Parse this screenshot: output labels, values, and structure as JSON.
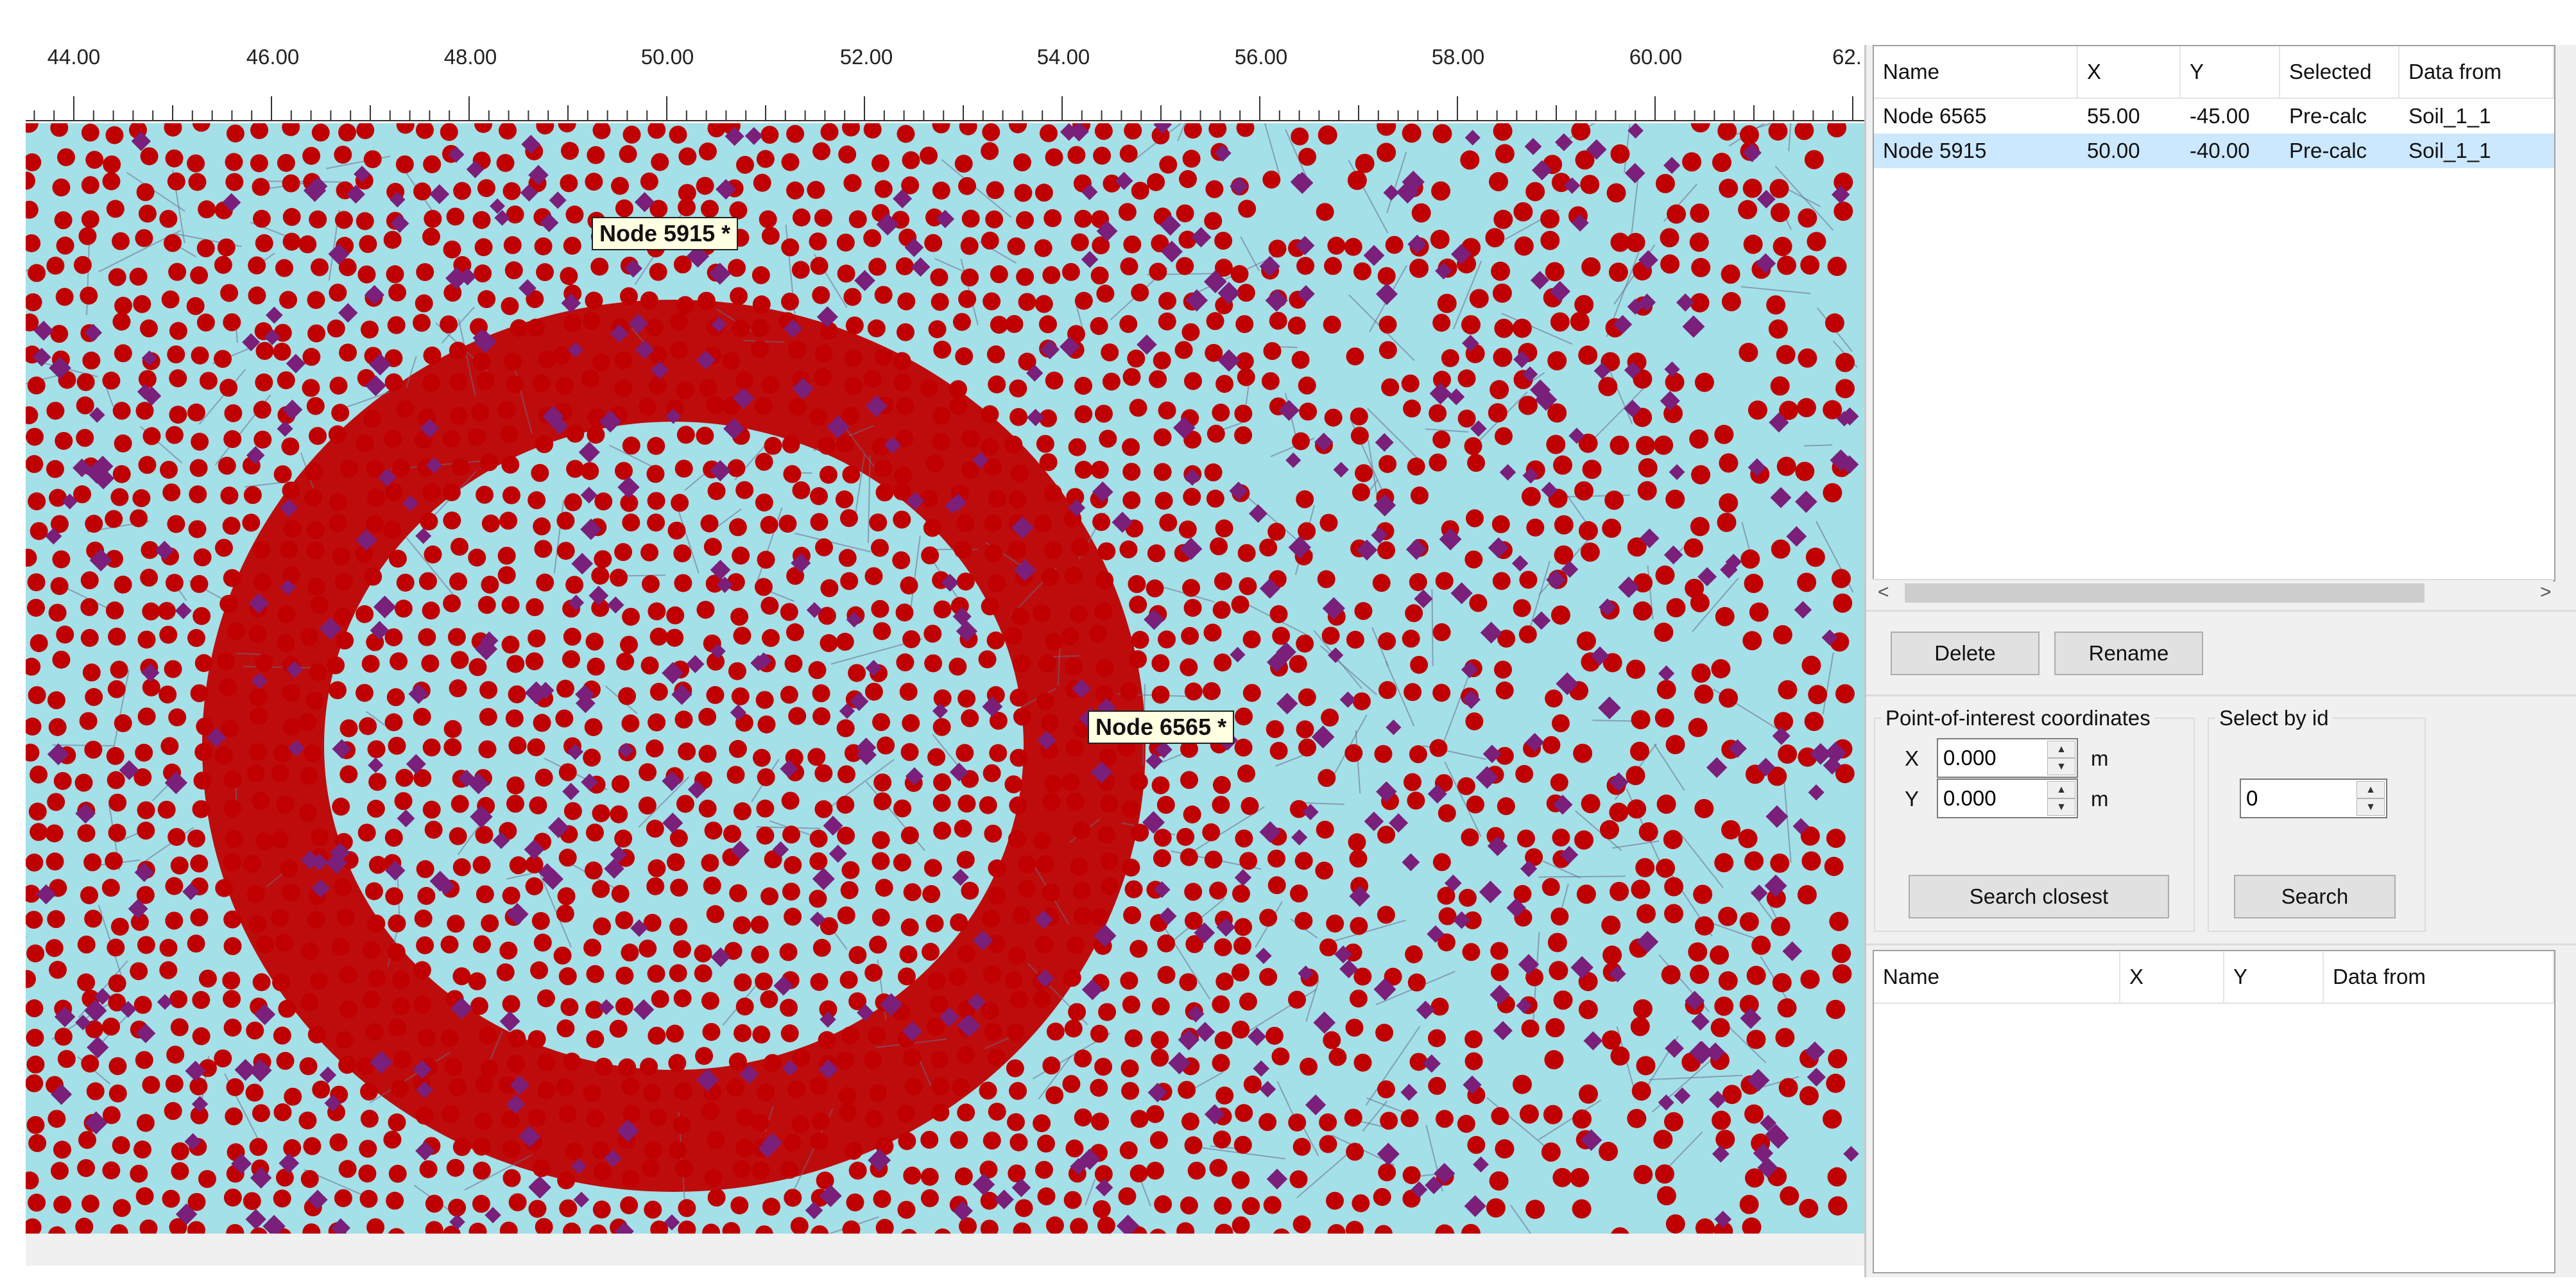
{
  "viewer": {
    "ruler_ticks": [
      "44.00",
      "46.00",
      "48.00",
      "50.00",
      "52.00",
      "54.00",
      "56.00",
      "58.00",
      "60.00",
      "62."
    ],
    "node_labels": [
      "Node 5915 *",
      "Node 6565 *"
    ],
    "colors": {
      "background": "#a4e0e8",
      "node_dot": "#c00000",
      "node_diamond": "#7a1f7a",
      "mesh_line": "#6b6b8a"
    }
  },
  "poi_table": {
    "columns": [
      "Name",
      "X",
      "Y",
      "Selected",
      "Data from"
    ],
    "rows": [
      [
        "Node 6565",
        "55.00",
        "-45.00",
        "Pre-calc",
        "Soil_1_1"
      ],
      [
        "Node 5915",
        "50.00",
        "-40.00",
        "Pre-calc",
        "Soil_1_1"
      ]
    ],
    "selected_row": 1
  },
  "buttons": {
    "delete": "Delete",
    "rename": "Rename",
    "search_closest": "Search closest",
    "search": "Search"
  },
  "coords": {
    "legend": "Point-of-interest coordinates",
    "x_label": "X",
    "y_label": "Y",
    "x_value": "0.000",
    "y_value": "0.000",
    "unit": "m"
  },
  "select_by_id": {
    "legend": "Select by id",
    "value": "0"
  },
  "results_table": {
    "columns": [
      "Name",
      "X",
      "Y",
      "Data from"
    ],
    "rows": []
  },
  "icons": {
    "scroll_left": "◄-arrow-icon",
    "scroll_right": "►-arrow-icon",
    "spin_up": "up-arrow-icon",
    "spin_down": "down-arrow-icon"
  }
}
